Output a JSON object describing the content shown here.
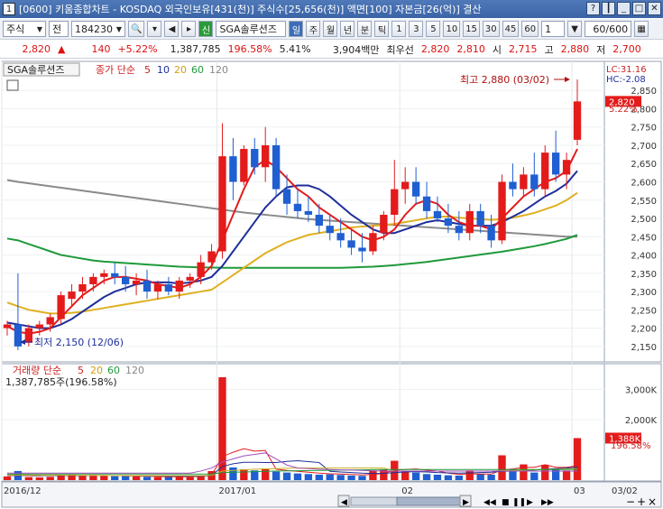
{
  "window": {
    "title": "[0600] 키움종합차트 - KOSDAQ 외국인보유[431(천)] 주식수[25,656(천)] 액면[100] 자본금[26(억)] 결산"
  },
  "toolbar": {
    "market": "주식",
    "market_sel": "전",
    "code": "184230",
    "credit_badge": "신",
    "stock_name": "SGA솔루션즈",
    "period_buttons": [
      "일",
      "주",
      "월",
      "년",
      "분",
      "틱"
    ],
    "interval_buttons": [
      "1",
      "3",
      "5",
      "10",
      "15",
      "30",
      "45",
      "60"
    ],
    "count_value": "1",
    "range_value": "60/600"
  },
  "quote": {
    "price": "2,820",
    "change_arrow": "▲",
    "change": "140",
    "change_pct": "+5.22%",
    "volume": "1,387,785",
    "volume_ratio": "196.58%",
    "turnover": "5.41%",
    "amount": "3,904백만",
    "best_label": "최우선",
    "best1": "2,820",
    "best2": "2,810",
    "open_label": "시",
    "open": "2,715",
    "high_label": "고",
    "high": "2,880",
    "low_label": "저",
    "low": "2,700"
  },
  "legend": {
    "stock": "SGA솔루션즈",
    "ma_label": "종가 단순",
    "ma_periods": [
      "5",
      "10",
      "20",
      "60",
      "120"
    ],
    "vol_label": "거래량 단순",
    "vol_value": "1,387,785주(196.58%)"
  },
  "colors": {
    "up": "#e31b1b",
    "down": "#1f5fd1",
    "ma5": "#e31b1b",
    "ma10": "#1f2f9a",
    "ma20": "#e0b020",
    "ma60": "#1f9a3a",
    "ma120": "#8a8a8a",
    "vol_ma5": "#e31b1b",
    "vol_ma10": "#1f2f9a",
    "vol_ma20": "#c8b020",
    "vol_ma60": "#1f9a3a",
    "vol_ma120": "#a050c0"
  },
  "annotations": {
    "high": "최고 2,880 (03/02)",
    "low": "최저 2,150 (12/06)",
    "lc": "LC:31.16",
    "hc": "HC:-2.08",
    "price_tag": "2,820",
    "pct_tag": "5.22%",
    "vol_tag": "1,388K",
    "vol_pct_tag": "196.58%"
  },
  "chart_data": [
    {
      "type": "candlestick",
      "title": "SGA솔루션즈",
      "y_ticks": [
        "2,850",
        "2,800",
        "2,750",
        "2,700",
        "2,650",
        "2,600",
        "2,550",
        "2,500",
        "2,450",
        "2,400",
        "2,350",
        "2,300",
        "2,250",
        "2,200",
        "2,150"
      ],
      "ylim": [
        2120,
        2890
      ],
      "x_labels": [
        "2016/12",
        "2017/01",
        "02",
        "03"
      ],
      "x_label_positions": [
        0,
        20,
        37,
        53
      ],
      "candles": [
        [
          2200,
          2220,
          2180,
          2210
        ],
        [
          2210,
          2350,
          2140,
          2150
        ],
        [
          2160,
          2210,
          2150,
          2200
        ],
        [
          2200,
          2220,
          2180,
          2210
        ],
        [
          2210,
          2240,
          2190,
          2230
        ],
        [
          2225,
          2300,
          2210,
          2290
        ],
        [
          2280,
          2320,
          2260,
          2300
        ],
        [
          2300,
          2340,
          2280,
          2320
        ],
        [
          2320,
          2350,
          2300,
          2340
        ],
        [
          2340,
          2360,
          2320,
          2350
        ],
        [
          2350,
          2380,
          2320,
          2340
        ],
        [
          2340,
          2370,
          2300,
          2320
        ],
        [
          2320,
          2350,
          2290,
          2330
        ],
        [
          2330,
          2360,
          2280,
          2300
        ],
        [
          2300,
          2330,
          2280,
          2320
        ],
        [
          2320,
          2340,
          2290,
          2300
        ],
        [
          2300,
          2340,
          2280,
          2330
        ],
        [
          2330,
          2350,
          2310,
          2340
        ],
        [
          2340,
          2400,
          2320,
          2380
        ],
        [
          2380,
          2430,
          2360,
          2410
        ],
        [
          2410,
          2760,
          2390,
          2670
        ],
        [
          2670,
          2720,
          2550,
          2600
        ],
        [
          2600,
          2700,
          2590,
          2690
        ],
        [
          2690,
          2720,
          2620,
          2640
        ],
        [
          2640,
          2750,
          2600,
          2700
        ],
        [
          2700,
          2720,
          2560,
          2580
        ],
        [
          2580,
          2620,
          2510,
          2540
        ],
        [
          2540,
          2580,
          2500,
          2520
        ],
        [
          2520,
          2560,
          2490,
          2510
        ],
        [
          2510,
          2540,
          2460,
          2480
        ],
        [
          2480,
          2510,
          2440,
          2460
        ],
        [
          2460,
          2500,
          2420,
          2440
        ],
        [
          2440,
          2470,
          2400,
          2420
        ],
        [
          2420,
          2460,
          2380,
          2410
        ],
        [
          2410,
          2480,
          2400,
          2460
        ],
        [
          2460,
          2520,
          2440,
          2510
        ],
        [
          2510,
          2660,
          2480,
          2580
        ],
        [
          2580,
          2640,
          2540,
          2600
        ],
        [
          2600,
          2640,
          2540,
          2560
        ],
        [
          2560,
          2600,
          2500,
          2520
        ],
        [
          2520,
          2560,
          2490,
          2500
        ],
        [
          2500,
          2540,
          2460,
          2480
        ],
        [
          2480,
          2520,
          2440,
          2460
        ],
        [
          2460,
          2540,
          2440,
          2520
        ],
        [
          2520,
          2540,
          2460,
          2480
        ],
        [
          2480,
          2510,
          2420,
          2440
        ],
        [
          2440,
          2620,
          2430,
          2600
        ],
        [
          2600,
          2650,
          2560,
          2580
        ],
        [
          2580,
          2640,
          2560,
          2620
        ],
        [
          2620,
          2680,
          2560,
          2580
        ],
        [
          2580,
          2700,
          2560,
          2680
        ],
        [
          2680,
          2740,
          2600,
          2620
        ],
        [
          2620,
          2680,
          2580,
          2660
        ],
        [
          2715,
          2880,
          2700,
          2820
        ]
      ],
      "ma": {
        "5": [
          2205,
          2190,
          2185,
          2190,
          2200,
          2230,
          2260,
          2290,
          2310,
          2330,
          2340,
          2340,
          2335,
          2330,
          2320,
          2315,
          2310,
          2320,
          2340,
          2370,
          2440,
          2510,
          2580,
          2640,
          2660,
          2640,
          2610,
          2580,
          2560,
          2530,
          2510,
          2490,
          2470,
          2450,
          2440,
          2450,
          2470,
          2510,
          2540,
          2550,
          2540,
          2510,
          2490,
          2480,
          2480,
          2470,
          2500,
          2530,
          2560,
          2580,
          2600,
          2610,
          2630,
          2690
        ],
        "10": [
          2215,
          2210,
          2205,
          2200,
          2200,
          2210,
          2225,
          2245,
          2265,
          2285,
          2300,
          2310,
          2320,
          2325,
          2325,
          2325,
          2322,
          2325,
          2330,
          2340,
          2370,
          2410,
          2450,
          2490,
          2530,
          2560,
          2585,
          2590,
          2590,
          2580,
          2560,
          2535,
          2510,
          2490,
          2470,
          2460,
          2460,
          2470,
          2480,
          2490,
          2495,
          2490,
          2485,
          2480,
          2480,
          2480,
          2490,
          2505,
          2520,
          2540,
          2560,
          2575,
          2595,
          2630
        ],
        "20": [
          2270,
          2260,
          2250,
          2245,
          2240,
          2240,
          2242,
          2245,
          2250,
          2255,
          2260,
          2265,
          2270,
          2275,
          2280,
          2285,
          2290,
          2295,
          2300,
          2305,
          2325,
          2345,
          2365,
          2385,
          2405,
          2420,
          2435,
          2445,
          2455,
          2460,
          2465,
          2470,
          2475,
          2478,
          2480,
          2482,
          2485,
          2490,
          2495,
          2500,
          2505,
          2505,
          2502,
          2500,
          2498,
          2496,
          2498,
          2502,
          2508,
          2515,
          2525,
          2535,
          2550,
          2570
        ],
        "60": [
          2445,
          2440,
          2430,
          2420,
          2410,
          2400,
          2395,
          2390,
          2385,
          2382,
          2380,
          2378,
          2376,
          2374,
          2372,
          2370,
          2368,
          2367,
          2366,
          2366,
          2365,
          2365,
          2365,
          2365,
          2365,
          2365,
          2365,
          2365,
          2365,
          2365,
          2365,
          2365,
          2366,
          2367,
          2368,
          2370,
          2372,
          2375,
          2378,
          2381,
          2385,
          2389,
          2393,
          2397,
          2401,
          2405,
          2409,
          2414,
          2419,
          2424,
          2430,
          2437,
          2444,
          2455
        ],
        "120": [
          2605,
          2600,
          2596,
          2592,
          2588,
          2584,
          2580,
          2576,
          2572,
          2568,
          2564,
          2560,
          2556,
          2552,
          2548,
          2544,
          2540,
          2536,
          2532,
          2528,
          2524,
          2520,
          2516,
          2513,
          2510,
          2507,
          2504,
          2501,
          2498,
          2496,
          2494,
          2492,
          2490,
          2488,
          2486,
          2484,
          2482,
          2480,
          2478,
          2476,
          2474,
          2472,
          2470,
          2468,
          2466,
          2464,
          2462,
          2460,
          2458,
          2456,
          2454,
          2452,
          2450,
          2450
        ]
      }
    },
    {
      "type": "bar",
      "title": "거래량",
      "y_ticks": [
        "3,000K",
        "2,000K"
      ],
      "ylim": [
        0,
        3400
      ],
      "volumes_k": [
        120,
        300,
        100,
        90,
        110,
        150,
        180,
        160,
        170,
        140,
        130,
        150,
        120,
        110,
        100,
        120,
        110,
        100,
        160,
        300,
        3400,
        420,
        360,
        320,
        380,
        280,
        250,
        220,
        200,
        180,
        190,
        170,
        150,
        140,
        300,
        350,
        640,
        300,
        250,
        200,
        180,
        160,
        150,
        320,
        200,
        180,
        820,
        350,
        520,
        250,
        500,
        360,
        320,
        1388
      ],
      "vol_ma": {
        "5": [
          150,
          160,
          150,
          140,
          160,
          160,
          140,
          150,
          150,
          150,
          150,
          140,
          135,
          130,
          120,
          115,
          110,
          110,
          125,
          160,
          780,
          920,
          1040,
          960,
          980,
          360,
          320,
          290,
          260,
          230,
          210,
          200,
          185,
          170,
          190,
          220,
          330,
          350,
          370,
          330,
          300,
          230,
          190,
          210,
          200,
          200,
          340,
          370,
          420,
          420,
          510,
          420,
          420,
          480
        ],
        "10": [
          160,
          160,
          155,
          150,
          150,
          150,
          150,
          150,
          150,
          150,
          150,
          148,
          145,
          142,
          140,
          138,
          135,
          132,
          135,
          150,
          450,
          540,
          590,
          590,
          580,
          580,
          620,
          640,
          610,
          580,
          290,
          270,
          250,
          230,
          220,
          220,
          250,
          270,
          280,
          270,
          250,
          240,
          230,
          240,
          250,
          260,
          290,
          300,
          320,
          330,
          360,
          380,
          400,
          430
        ],
        "20": [
          170,
          168,
          166,
          164,
          162,
          160,
          158,
          156,
          154,
          152,
          150,
          150,
          150,
          150,
          150,
          150,
          150,
          150,
          150,
          155,
          300,
          320,
          340,
          360,
          370,
          380,
          390,
          400,
          400,
          400,
          400,
          400,
          400,
          400,
          400,
          400,
          300,
          300,
          300,
          300,
          300,
          300,
          300,
          300,
          300,
          300,
          310,
          320,
          330,
          340,
          350,
          360,
          370,
          380
        ],
        "60": [
          200,
          200,
          200,
          200,
          200,
          200,
          200,
          200,
          200,
          200,
          200,
          200,
          200,
          200,
          200,
          200,
          200,
          200,
          200,
          200,
          250,
          260,
          270,
          280,
          290,
          300,
          305,
          310,
          315,
          320,
          325,
          330,
          335,
          340,
          345,
          350,
          350,
          350,
          350,
          350,
          350,
          350,
          350,
          350,
          350,
          350,
          350,
          350,
          350,
          350,
          350,
          350,
          350,
          360
        ],
        "120": [
          230,
          230,
          230,
          230,
          230,
          230,
          230,
          230,
          230,
          230,
          230,
          230,
          230,
          230,
          230,
          230,
          230,
          230,
          300,
          400,
          600,
          700,
          800,
          850,
          900,
          700,
          500,
          400,
          380,
          360,
          350,
          340,
          330,
          320,
          310,
          300,
          300,
          300,
          300,
          300,
          300,
          300,
          300,
          300,
          300,
          300,
          300,
          300,
          300,
          300,
          300,
          300,
          300,
          300
        ]
      }
    }
  ]
}
